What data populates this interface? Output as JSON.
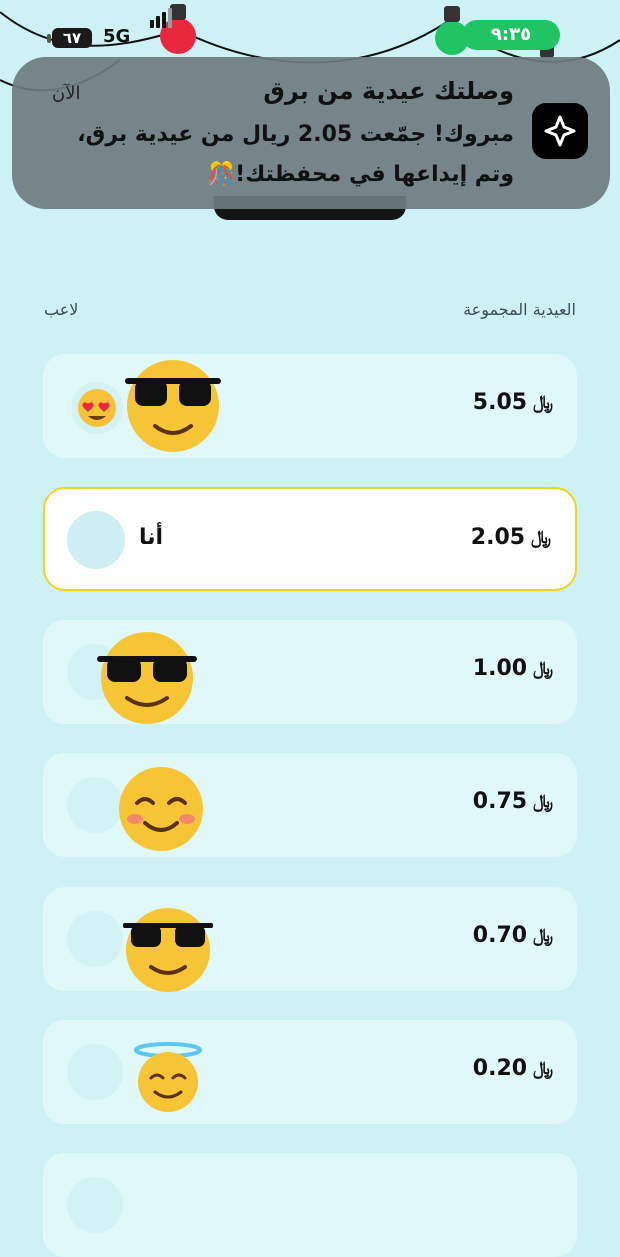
{
  "status_bar": {
    "battery": "٦٧",
    "network": "5G",
    "time": "٩:٣٥"
  },
  "notification": {
    "title": "وصلتك عيدية من برق",
    "time": "الآن",
    "line1": "مبروك! جمّعت 2.05 ريال من عيدية برق،",
    "line2": "وتم إيداعها في محفظتك!🎊"
  },
  "headers": {
    "collected": "العيدية المجموعة",
    "player": "لاعب"
  },
  "currency_symbol": "⃁",
  "rows": [
    {
      "amount": "5.05",
      "avatar": "sunglasses-emoji",
      "extra": "heart-eyes-emoji",
      "is_me": false
    },
    {
      "amount": "2.05",
      "label": "أنا",
      "is_me": true
    },
    {
      "amount": "1.00",
      "avatar": "sunglasses-emoji",
      "is_me": false
    },
    {
      "amount": "0.75",
      "avatar": "smiling-blush-emoji",
      "is_me": false
    },
    {
      "amount": "0.70",
      "avatar": "sunglasses-emoji",
      "is_me": false
    },
    {
      "amount": "0.20",
      "avatar": "halo-emoji",
      "is_me": false
    }
  ],
  "colors": {
    "background": "#cdf1f5",
    "row": "#e0f8fa",
    "highlight_border": "#f2d41e",
    "time_pill": "#20c463"
  }
}
